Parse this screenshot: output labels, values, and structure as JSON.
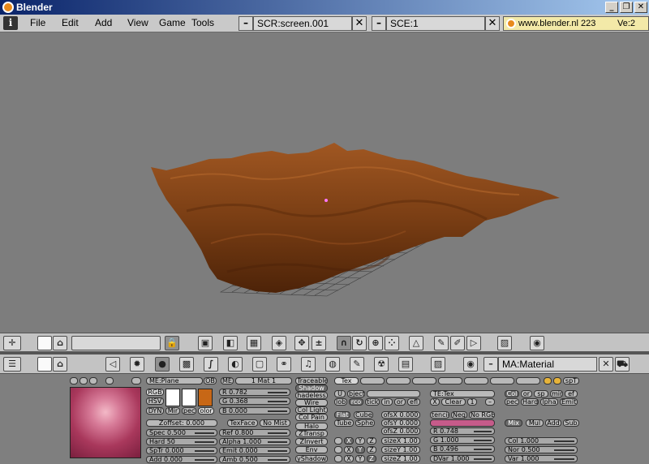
{
  "window": {
    "title": "Blender",
    "minimize": "_",
    "restore": "❐",
    "close": "✕"
  },
  "menubar": {
    "menus": [
      "File",
      "Edit",
      "Add",
      "View",
      "Game",
      "Tools"
    ],
    "screen": "SCR:screen.001",
    "scene": "SCE:1",
    "site": "www.blender.nl  223",
    "ve": "Ve:2",
    "minus": "–",
    "x": "✕"
  },
  "viewport": {
    "mesh_color": "#7a3e14",
    "grid_color": "#3c3c3c",
    "bg": "#7d7d7d"
  },
  "buttons_header": {
    "material": "MA:Material",
    "x": "✕"
  },
  "material": {
    "mesh": "ME:Plane",
    "ob": "OB",
    "me": "ME",
    "mat": "1 Mat 1",
    "rgb": "RGB",
    "hsv": "HSV",
    "dyn": "DYN",
    "mir": "Mir",
    "pec": "pec",
    "olor": "olor",
    "r": "R 0.782",
    "g": "G 0.368",
    "b": "B 0.000",
    "zoffset": "Zoffset: 0.000",
    "texface": "TexFace",
    "nomist": "No Mist",
    "spec": "Spec 0.500",
    "hard": "Hard 50",
    "sptr": "SpTr 0.000",
    "add": "Add  0.000",
    "ref": "Ref  0.800",
    "alpha": "Alpha 1.000",
    "emit": "Emit 0.000",
    "amb": "Amb  0.500",
    "traceable": "Traceable",
    "shadow": "Shadow",
    "shadeless": "hadeless",
    "wire": "Wire",
    "collight": "Col Light",
    "colpaint": "Col Pain",
    "halo": "Halo",
    "ztransp": "ZTransp",
    "zinvert": "ZInvert",
    "env": "Env",
    "oshadow": "yShadow",
    "swatch_colors": [
      "#ffffff",
      "#ffffff",
      "#c76716"
    ]
  },
  "texture": {
    "tex": "Tex",
    "u": "U",
    "object": "bject",
    "glob": "lob",
    "orco": "rco",
    "stick": "tick",
    "win": "in",
    "nor": "or",
    "refl": "efl",
    "tetex": "TE:Tex",
    "x": "X",
    "clear": "Clear",
    "one": "1",
    "minus": "–",
    "flat": "Flat",
    "cube": "Cube",
    "tube": "Tube",
    "sphe": "Sphe",
    "ofsx": "ofsX 0.000",
    "ofsy": "ofsY 0.000",
    "ofsz": "ofsZ 0.000",
    "sizex": "sizeX 1.00",
    "sizey": "sizeY 1.00",
    "sizez": "sizeZ 1.00",
    "stencil": "tencil",
    "neg": "Neg",
    "norgb": "No RGB",
    "tr": "R 0.748",
    "tg": "G 1.000",
    "tb": "B 0.496",
    "dvar": "DVar 1.000",
    "xyz": [
      "X",
      "Y",
      "Z"
    ],
    "col": "Col",
    "nor2": "or",
    "csp": "sp",
    "cmir": "mir",
    "ref": "ef",
    "spec": "pec",
    "hard": "Hard",
    "alpha": "lpha",
    "emit": "Emit",
    "mix": "Mix",
    "mul": "Mul",
    "addb": "Add",
    "sub": "Sub",
    "col_v": "Col 1.000",
    "nor_v": "Nor 0.500",
    "var_v": "Var 1.000",
    "spt": "spT"
  }
}
